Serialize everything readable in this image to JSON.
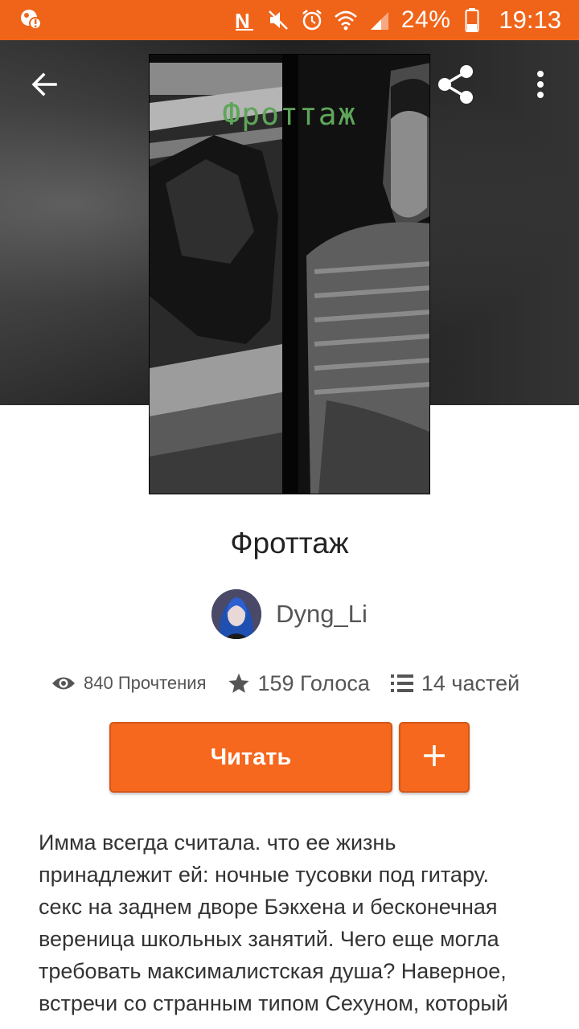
{
  "status_bar": {
    "battery_percent": "24%",
    "time": "19:13",
    "icons": [
      "app-notification-icon",
      "nfc-icon",
      "mute-icon",
      "alarm-icon",
      "wifi-icon",
      "signal-icon",
      "battery-icon"
    ],
    "color": "#f0641a"
  },
  "header": {
    "icons": [
      "back-arrow-icon",
      "share-icon",
      "more-vertical-icon"
    ]
  },
  "cover": {
    "title_text": "Фроттаж"
  },
  "story": {
    "title": "Фроттаж",
    "author": "Dyng_Li",
    "stats": {
      "reads": "840 Прочтения",
      "votes": "159 Голоса",
      "parts": "14 частей"
    },
    "read_button_label": "Читать",
    "add_button_icon": "plus-icon",
    "description_lines": [
      "Имма всегда считала. что ее жизнь",
      "принадлежит ей: ночные тусовки под гитару.",
      "секс на заднем дворе Бэкхена и бесконечная",
      "вереница школьных занятий.  Чего еще могла",
      "требовать максималистская душа? Наверное,",
      "встречи со странным типом Сехуном, который"
    ]
  },
  "colors": {
    "accent": "#f5681d",
    "accent_border": "#d4571a",
    "cover_title": "#5fa55a"
  }
}
